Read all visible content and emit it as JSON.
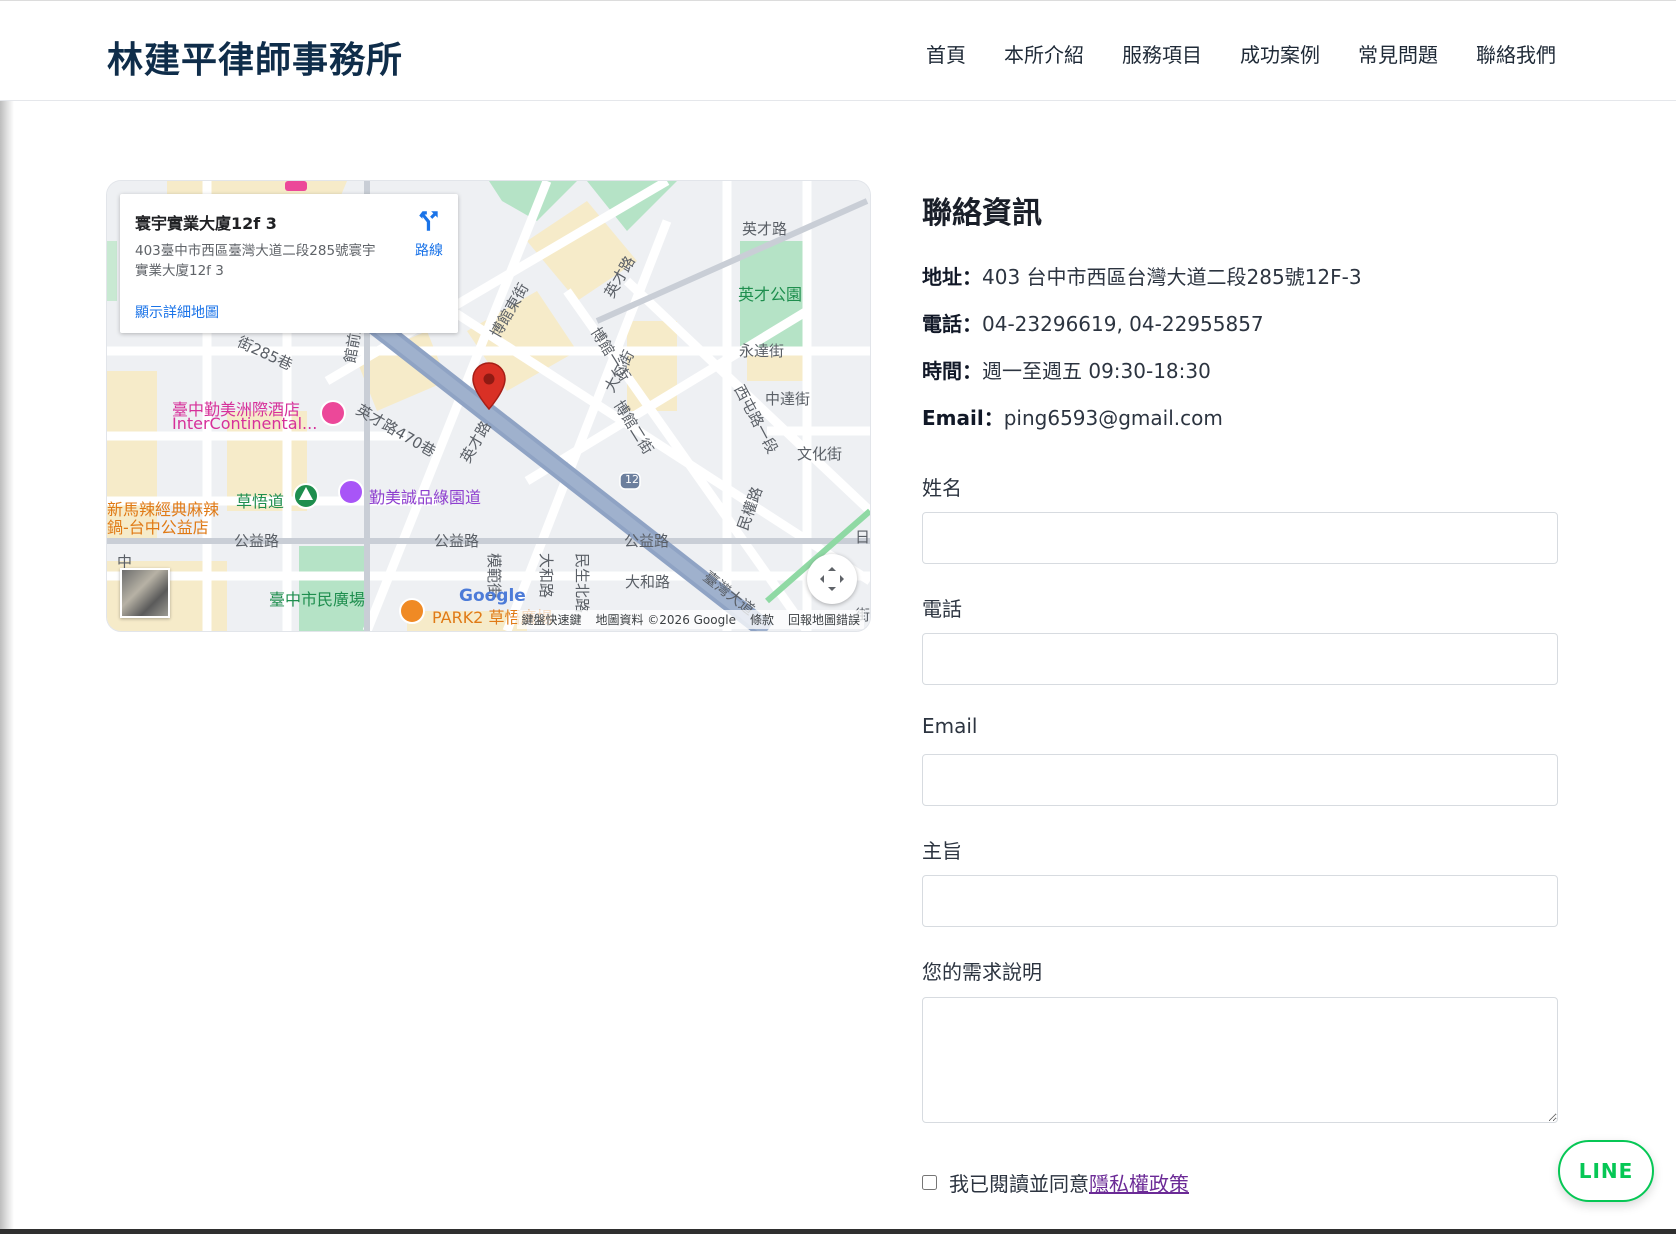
{
  "site": {
    "title": "林建平律師事務所"
  },
  "nav": {
    "items": [
      {
        "label": "首頁"
      },
      {
        "label": "本所介紹"
      },
      {
        "label": "服務項目"
      },
      {
        "label": "成功案例"
      },
      {
        "label": "常見問題"
      },
      {
        "label": "聯絡我們"
      }
    ]
  },
  "map": {
    "card": {
      "title": "寰宇實業大廈12f 3",
      "address": "403臺中市西區臺灣大道二段285號寰宇實業大廈12f 3",
      "directions_label": "路線",
      "larger_map_link": "顯示詳細地圖"
    },
    "labels": {
      "yingcai_rd": "英才路",
      "yingcai_park": "英才公園",
      "yongda_st": "永達街",
      "zhongda_st": "中達街",
      "wenhua_st": "文化街",
      "boguan_east": "博館東街",
      "boguan_1": "博館一街",
      "boguan_2": "博館二街",
      "daren_st": "大仁街",
      "xitun_rd": "西屯路一段",
      "minquan_rd": "民權路",
      "yingcai_470": "英才路470巷",
      "yingcai_rd2": "英才路",
      "lane_285": "街285巷",
      "guanqian_rd": "館前路",
      "hotel_cn": "臺中勤美洲際酒店",
      "hotel_en": "InterContinental...",
      "caowu_dao": "草悟道",
      "cmp_village": "勤美誠品綠園道",
      "restaurant_1": "新馬辣經典麻辣",
      "restaurant_2": "鍋-台中公益店",
      "gongyi_rd_1": "公益路",
      "gongyi_rd_2": "公益路",
      "gongyi_rd_3": "公益路",
      "mosquare": "臺中市民廣場",
      "park2": "PARK2 草悟廣場",
      "mofan_st": "模範街",
      "dahe_rd": "大和路",
      "minsheng_n": "民生北路",
      "dahe_rd2": "大和路",
      "taiwan_blvd": "臺灣大道",
      "route_12": "12",
      "zhong": "中",
      "ri": "日",
      "jie": "街"
    },
    "google_logo": "Google",
    "footer": {
      "shortcuts": "鍵盤快速鍵",
      "map_data": "地圖資料 ©2026 Google",
      "terms": "條款",
      "report": "回報地圖錯誤"
    }
  },
  "contact": {
    "heading": "聯絡資訊",
    "address_label": "地址：",
    "address_value": "403 台中市西區台灣大道二段285號12F-3",
    "phone_label": "電話：",
    "phone_value": "04-23296619, 04-22955857",
    "hours_label": "時間：",
    "hours_value": "週一至週五 09:30-18:30",
    "email_label": "Email：",
    "email_value": "ping6593@gmail.com"
  },
  "form": {
    "name_label": "姓名",
    "phone_label": "電話",
    "email_label": "Email",
    "subject_label": "主旨",
    "message_label": "您的需求說明",
    "consent_text": "我已閱讀並同意",
    "privacy_link": "隱私權政策"
  },
  "line_button": {
    "label": "LINE"
  },
  "colors": {
    "brand": "#0f2d4a",
    "line_green": "#06c755",
    "map_road_main": "#8fa3c4",
    "map_pin": "#d93025"
  }
}
